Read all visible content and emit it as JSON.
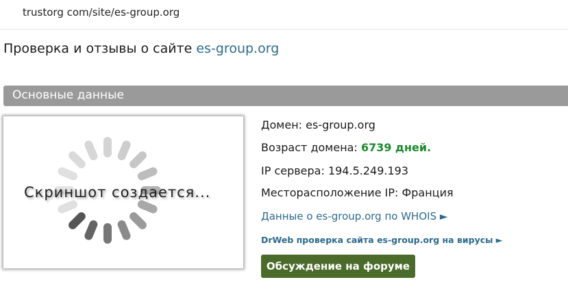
{
  "browser": {
    "url": "trustorg com/site/es-group.org"
  },
  "page": {
    "title_prefix": "Проверка и отзывы о сайте",
    "title_domain": "es-group.org"
  },
  "section": {
    "title": "Основные данные"
  },
  "screenshot": {
    "placeholder_text": "Скриншот создается..."
  },
  "info": {
    "domain_label": "Домен:",
    "domain_value": "es-group.org",
    "age_label": "Возраст домена:",
    "age_value": "6739 дней.",
    "ip_label": "IP сервера:",
    "ip_value": "194.5.249.193",
    "location_label": "Месторасположение IP:",
    "location_value": "Франция"
  },
  "links": {
    "whois": "Данные о es-group.org по WHOIS ►",
    "drweb": "DrWeb проверка сайта es-group.org на вирусы ►"
  },
  "buttons": {
    "forum": "Обсуждение на форуме"
  },
  "colors": {
    "link": "#2b6a8c",
    "age_green": "#1e8a2e",
    "section_bar": "#9a9a9a",
    "forum_button": "#4b6b2a"
  }
}
